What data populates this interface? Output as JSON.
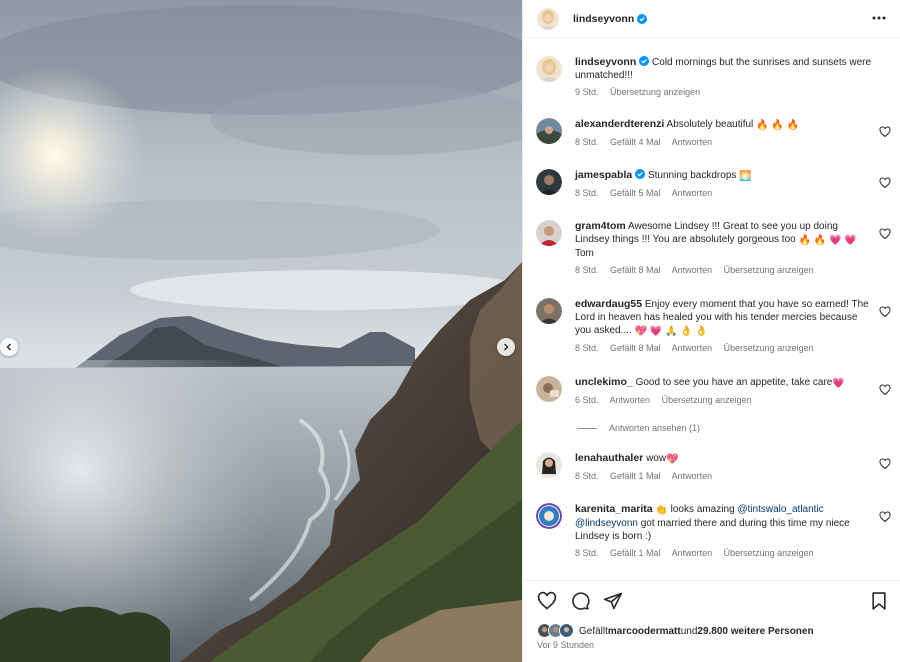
{
  "post": {
    "username": "lindseyvonn",
    "caption": "Cold mornings but the sunrises and sunsets were unmatched!!!",
    "caption_time": "9 Std.",
    "caption_translate": "Übersetzung anzeigen"
  },
  "comments": [
    {
      "user": "alexanderdterenzi",
      "text": "Absolutely beautiful ",
      "emoji": "🔥 🔥 🔥",
      "time": "8 Std.",
      "likes": "Gefällt 4 Mal",
      "reply": "Antworten",
      "translate": ""
    },
    {
      "user": "jamespabla",
      "verified": true,
      "text": "Stunning backdrops ",
      "emoji": "🌅",
      "time": "8 Std.",
      "likes": "Gefällt 5 Mal",
      "reply": "Antworten",
      "translate": ""
    },
    {
      "user": "gram4tom",
      "text": "Awesome Lindsey !!! Great to see you up doing Lindsey things !!! You are absolutely gorgeous too ",
      "emoji": "🔥 🔥 💗 💗",
      "text2": " Tom",
      "time": "8 Std.",
      "likes": "Gefällt 8 Mal",
      "reply": "Antworten",
      "translate": "Übersetzung anzeigen"
    },
    {
      "user": "edwardaug55",
      "text": "Enjoy every moment that you have so earned! The Lord in heaven has healed you with his tender mercies because you asked.... ",
      "emoji": "💖 💗 🙏 👌 👌",
      "time": "8 Std.",
      "likes": "Gefällt 8 Mal",
      "reply": "Antworten",
      "translate": "Übersetzung anzeigen"
    },
    {
      "user": "unclekimo_",
      "text": "Good to see you have an appetite, take care",
      "emoji": "💗",
      "time": "6 Std.",
      "likes": "",
      "reply": "Antworten",
      "translate": "Übersetzung anzeigen"
    },
    {
      "user": "lenahauthaler",
      "text": "wow",
      "emoji": "💖",
      "time": "8 Std.",
      "likes": "Gefällt 1 Mal",
      "reply": "Antworten",
      "translate": ""
    },
    {
      "user": "karenita_marita",
      "text": " looks amazing ",
      "emoji_lead": "👏",
      "mention1": "@tintswalo_atlantic",
      "mention2": "@lindseyvonn",
      "text_after": " got married there and during this time my niece Lindsey is born :)",
      "time": "8 Std.",
      "likes": "Gefällt 1 Mal",
      "reply": "Antworten",
      "translate": "Übersetzung anzeigen"
    }
  ],
  "view_replies": "Antworten ansehen (1)",
  "footer": {
    "likes_prefix": "Gefällt ",
    "liked_by": "marcoodermatt",
    "likes_mid": " und ",
    "likes_count": "29.800 weitere Personen",
    "posted_ago": "Vor 9 Stunden"
  },
  "icons": {
    "more": "more-icon",
    "verified": "verified-badge-icon",
    "heart": "heart-icon",
    "comment": "comment-icon",
    "share": "share-icon",
    "bookmark": "bookmark-icon",
    "prev": "chevron-left-icon",
    "next": "chevron-right-icon"
  },
  "colors": {
    "verified": "#0095f6",
    "text": "#262626",
    "secondary": "#737373",
    "mention": "#00376b",
    "divider": "#efefef"
  }
}
